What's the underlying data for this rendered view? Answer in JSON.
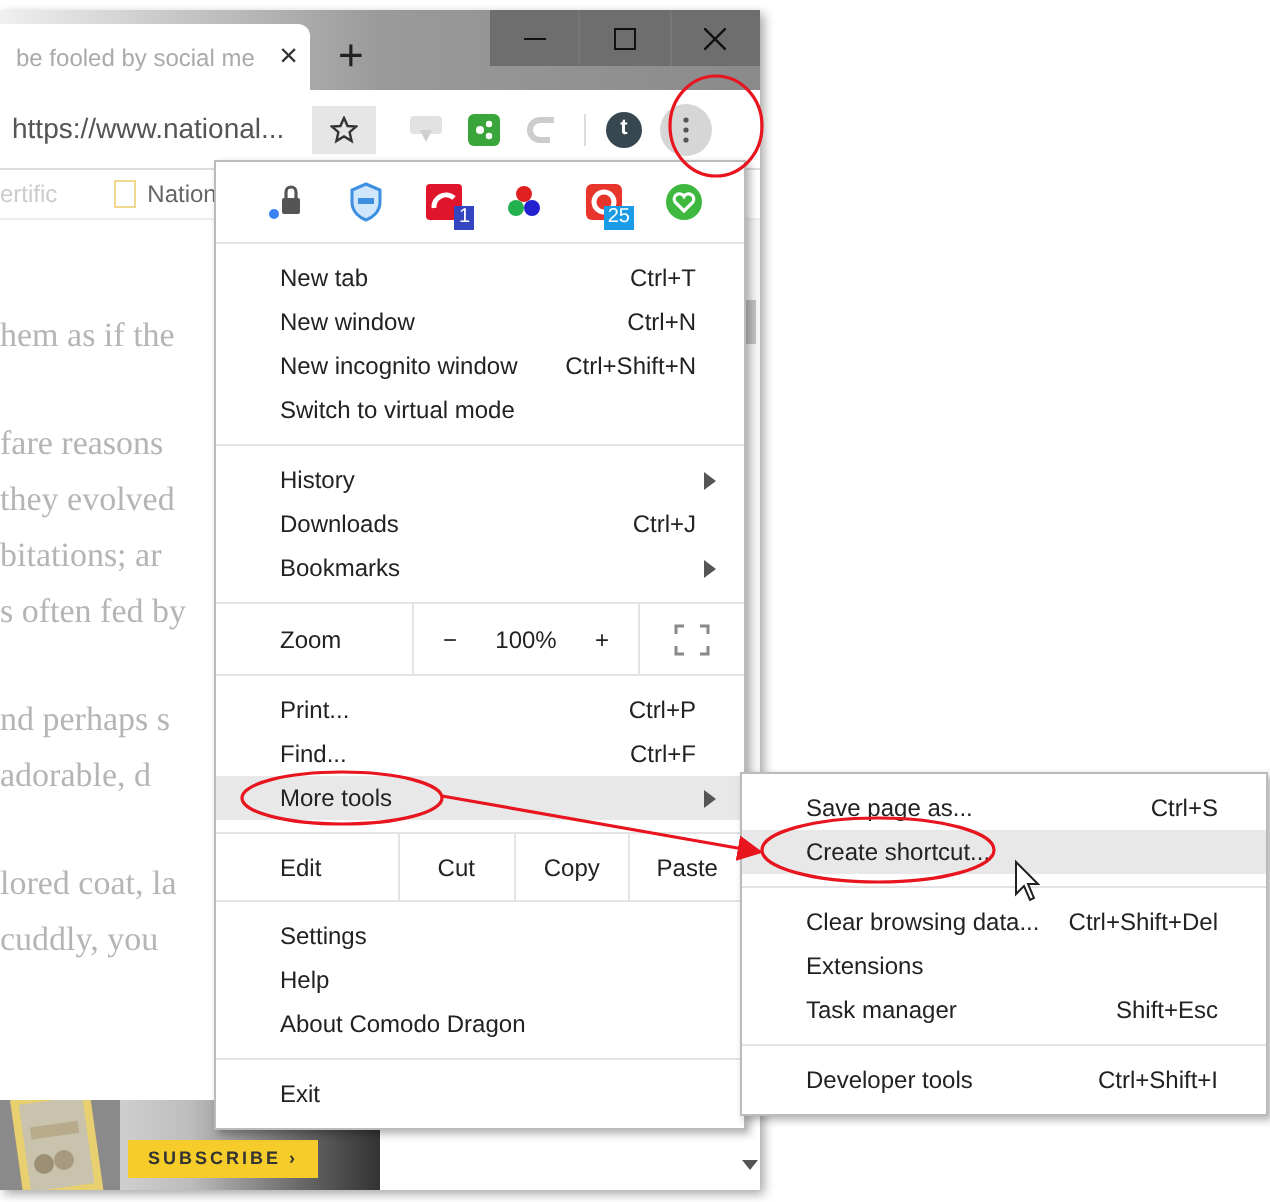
{
  "browser": {
    "tab": {
      "title": "be fooled by social me",
      "close": "×"
    },
    "new_tab": "+",
    "url": "https://www.national...",
    "avatar": "t",
    "bookmarks": [
      {
        "kind": "text",
        "label": "ertific"
      },
      {
        "kind": "folder",
        "label": "Nation"
      }
    ],
    "page_paragraphs": [
      [
        "hem as if the"
      ],
      [
        "fare reasons",
        "they evolved",
        "bitations; ar",
        "s often fed by"
      ],
      [
        "nd perhaps s",
        "adorable, d"
      ],
      [
        "lored coat, la",
        "cuddly, you"
      ]
    ],
    "ad": {
      "button": "SUBSCRIBE ›"
    }
  },
  "menu": {
    "extensions": [
      {
        "kind": "lock"
      },
      {
        "kind": "shield"
      },
      {
        "kind": "red-square",
        "badge": "1"
      },
      {
        "kind": "dots"
      },
      {
        "kind": "red-circle",
        "badge": "25"
      },
      {
        "kind": "heart"
      }
    ],
    "sections": [
      {
        "rows": [
          {
            "kind": "item",
            "label": "New tab",
            "shortcut": "Ctrl+T",
            "submenu": false,
            "selected": false
          },
          {
            "kind": "item",
            "label": "New window",
            "shortcut": "Ctrl+N",
            "submenu": false,
            "selected": false
          },
          {
            "kind": "item",
            "label": "New incognito window",
            "shortcut": "Ctrl+Shift+N",
            "submenu": false,
            "selected": false
          },
          {
            "kind": "item",
            "label": "Switch to virtual mode",
            "submenu": false,
            "selected": false
          }
        ]
      },
      {
        "rows": [
          {
            "kind": "item",
            "label": "History",
            "submenu": true,
            "selected": false
          },
          {
            "kind": "item",
            "label": "Downloads",
            "shortcut": "Ctrl+J",
            "submenu": false,
            "selected": false
          },
          {
            "kind": "item",
            "label": "Bookmarks",
            "submenu": true,
            "selected": false
          }
        ]
      },
      {
        "rows": [
          {
            "kind": "zoom",
            "label": "Zoom",
            "minus": "−",
            "value": "100%",
            "plus": "+"
          }
        ]
      },
      {
        "rows": [
          {
            "kind": "item",
            "label": "Print...",
            "shortcut": "Ctrl+P",
            "submenu": false,
            "selected": false
          },
          {
            "kind": "item",
            "label": "Find...",
            "shortcut": "Ctrl+F",
            "submenu": false,
            "selected": false
          },
          {
            "kind": "item",
            "label": "More tools",
            "submenu": true,
            "selected": true
          }
        ]
      },
      {
        "rows": [
          {
            "kind": "edit",
            "label": "Edit",
            "buttons": [
              "Cut",
              "Copy",
              "Paste"
            ]
          }
        ]
      },
      {
        "rows": [
          {
            "kind": "item",
            "label": "Settings",
            "submenu": false,
            "selected": false
          },
          {
            "kind": "item",
            "label": "Help",
            "submenu": false,
            "selected": false
          },
          {
            "kind": "item",
            "label": "About Comodo Dragon",
            "submenu": false,
            "selected": false
          }
        ]
      },
      {
        "rows": [
          {
            "kind": "item",
            "label": "Exit",
            "submenu": false,
            "selected": false
          }
        ]
      }
    ]
  },
  "submenu": {
    "sections": [
      {
        "rows": [
          {
            "kind": "item",
            "label": "Save page as...",
            "shortcut": "Ctrl+S",
            "submenu": false,
            "selected": false
          },
          {
            "kind": "item",
            "label": "Create shortcut...",
            "submenu": false,
            "selected": true
          }
        ]
      },
      {
        "rows": [
          {
            "kind": "item",
            "label": "Clear browsing data...",
            "shortcut": "Ctrl+Shift+Del",
            "submenu": false,
            "selected": false
          },
          {
            "kind": "item",
            "label": "Extensions",
            "submenu": false,
            "selected": false
          },
          {
            "kind": "item",
            "label": "Task manager",
            "shortcut": "Shift+Esc",
            "submenu": false,
            "selected": false
          }
        ]
      },
      {
        "rows": [
          {
            "kind": "item",
            "label": "Developer tools",
            "shortcut": "Ctrl+Shift+I",
            "submenu": false,
            "selected": false
          }
        ]
      }
    ]
  }
}
